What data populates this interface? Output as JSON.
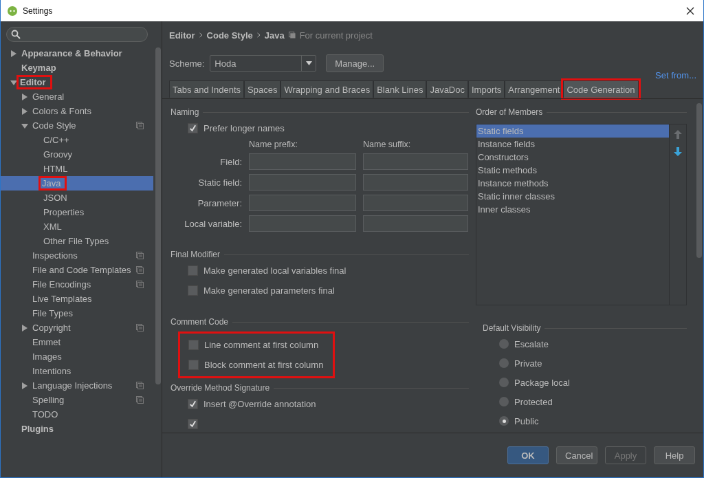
{
  "window": {
    "title": "Settings"
  },
  "sidebar": {
    "items": [
      {
        "label": "Appearance & Behavior",
        "expanded": false,
        "selected": false
      },
      {
        "label": "Keymap",
        "selected": false
      },
      {
        "label": "Editor",
        "expanded": true,
        "selected": false,
        "highlighted": true,
        "children": [
          {
            "label": "General",
            "expanded": false,
            "selected": false
          },
          {
            "label": "Colors & Fonts",
            "expanded": false,
            "selected": false
          },
          {
            "label": "Code Style",
            "expanded": true,
            "selected": false,
            "project_scope": true,
            "children": [
              {
                "label": "C/C++",
                "selected": false
              },
              {
                "label": "Groovy",
                "selected": false
              },
              {
                "label": "HTML",
                "selected": false
              },
              {
                "label": "Java",
                "selected": true,
                "highlighted": true
              },
              {
                "label": "JSON",
                "selected": false
              },
              {
                "label": "Properties",
                "selected": false
              },
              {
                "label": "XML",
                "selected": false
              },
              {
                "label": "Other File Types",
                "selected": false
              }
            ]
          },
          {
            "label": "Inspections",
            "selected": false,
            "project_scope": true
          },
          {
            "label": "File and Code Templates",
            "selected": false,
            "project_scope": true
          },
          {
            "label": "File Encodings",
            "selected": false,
            "project_scope": true
          },
          {
            "label": "Live Templates",
            "selected": false
          },
          {
            "label": "File Types",
            "selected": false
          },
          {
            "label": "Copyright",
            "expanded": false,
            "selected": false,
            "project_scope": true
          },
          {
            "label": "Emmet",
            "selected": false
          },
          {
            "label": "Images",
            "selected": false
          },
          {
            "label": "Intentions",
            "selected": false
          },
          {
            "label": "Language Injections",
            "expanded": false,
            "selected": false,
            "project_scope": true
          },
          {
            "label": "Spelling",
            "selected": false,
            "project_scope": true
          },
          {
            "label": "TODO",
            "selected": false
          }
        ]
      },
      {
        "label": "Plugins",
        "selected": false
      }
    ]
  },
  "breadcrumb": [
    "Editor",
    "Code Style",
    "Java"
  ],
  "scope_note": "For current project",
  "scheme": {
    "label": "Scheme:",
    "value": "Hoda",
    "manage": "Manage...",
    "set_from": "Set from..."
  },
  "tabs": [
    {
      "label": "Tabs and Indents",
      "selected": false
    },
    {
      "label": "Spaces",
      "selected": false
    },
    {
      "label": "Wrapping and Braces",
      "selected": false
    },
    {
      "label": "Blank Lines",
      "selected": false
    },
    {
      "label": "JavaDoc",
      "selected": false
    },
    {
      "label": "Imports",
      "selected": false
    },
    {
      "label": "Arrangement",
      "selected": false
    },
    {
      "label": "Code Generation",
      "selected": true,
      "highlighted": true
    }
  ],
  "naming": {
    "title": "Naming",
    "prefer_longer": {
      "label": "Prefer longer names",
      "checked": true
    },
    "prefix_heading": "Name prefix:",
    "suffix_heading": "Name suffix:",
    "rows": [
      {
        "label": "Field:"
      },
      {
        "label": "Static field:"
      },
      {
        "label": "Parameter:"
      },
      {
        "label": "Local variable:"
      }
    ]
  },
  "final_modifier": {
    "title": "Final Modifier",
    "options": [
      {
        "label": "Make generated local variables final",
        "checked": false
      },
      {
        "label": "Make generated parameters final",
        "checked": false
      }
    ]
  },
  "comment_code": {
    "title": "Comment Code",
    "highlighted": true,
    "options": [
      {
        "label": "Line comment at first column",
        "checked": false
      },
      {
        "label": "Block comment at first column",
        "checked": false
      }
    ]
  },
  "override": {
    "title": "Override Method Signature",
    "options": [
      {
        "label": "Insert @Override annotation",
        "checked": true
      },
      {
        "checked": true
      }
    ]
  },
  "order_of_members": {
    "title": "Order of Members",
    "items": [
      {
        "label": "Static fields",
        "selected": true
      },
      {
        "label": "Instance fields",
        "selected": false
      },
      {
        "label": "Constructors",
        "selected": false
      },
      {
        "label": "Static methods",
        "selected": false
      },
      {
        "label": "Instance methods",
        "selected": false
      },
      {
        "label": "Static inner classes",
        "selected": false
      },
      {
        "label": "Inner classes",
        "selected": false
      }
    ]
  },
  "default_visibility": {
    "title": "Default Visibility",
    "options": [
      {
        "label": "Escalate",
        "selected": false
      },
      {
        "label": "Private",
        "selected": false
      },
      {
        "label": "Package local",
        "selected": false
      },
      {
        "label": "Protected",
        "selected": false
      },
      {
        "label": "Public",
        "selected": true
      }
    ]
  },
  "buttons": [
    {
      "label": "OK",
      "kind": "default",
      "disabled": false
    },
    {
      "label": "Cancel",
      "kind": "normal",
      "disabled": false
    },
    {
      "label": "Apply",
      "kind": "normal",
      "disabled": true
    },
    {
      "label": "Help",
      "kind": "normal",
      "disabled": false
    }
  ]
}
